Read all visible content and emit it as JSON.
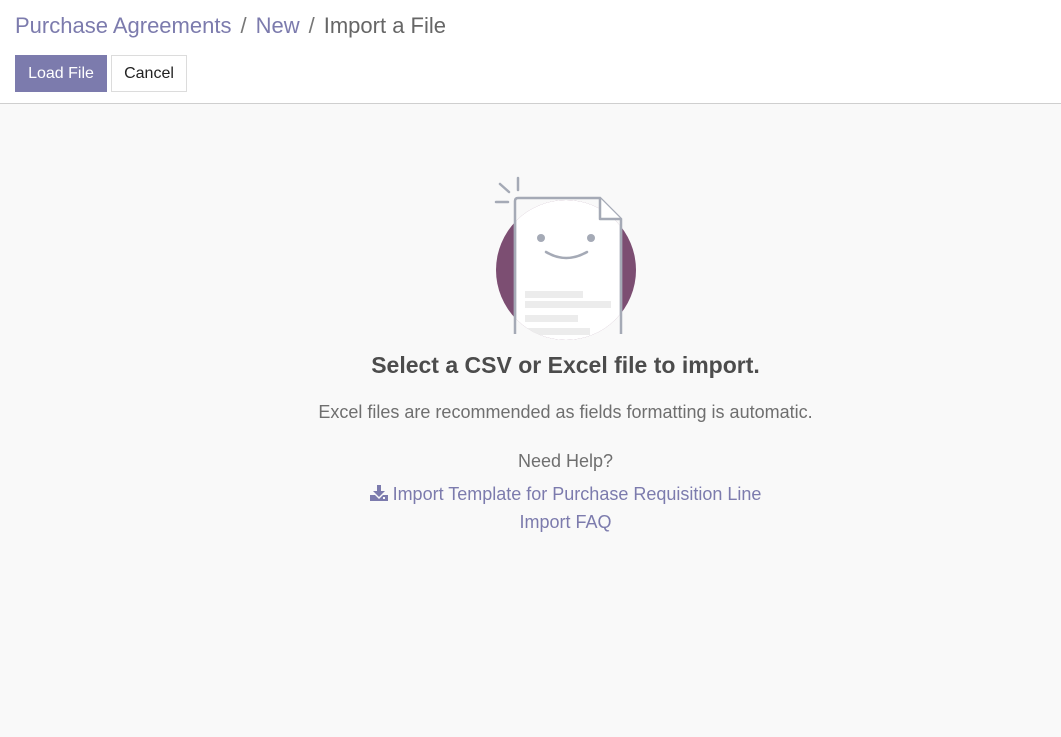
{
  "breadcrumb": {
    "items": [
      "Purchase Agreements",
      "New"
    ],
    "separator": "/",
    "current": "Import a File"
  },
  "toolbar": {
    "load_label": "Load File",
    "cancel_label": "Cancel"
  },
  "main": {
    "title": "Select a CSV or Excel file to import.",
    "subtitle": "Excel files are recommended as fields formatting is automatic.",
    "help_title": "Need Help?",
    "template_link": "Import Template for Purchase Requisition Line",
    "faq_link": "Import FAQ"
  },
  "icons": {
    "download": "download-icon",
    "illustration": "smiling-document-illustration"
  },
  "colors": {
    "accent": "#7c7bad",
    "circle": "#7c4e72",
    "background": "#f9f9f9"
  }
}
